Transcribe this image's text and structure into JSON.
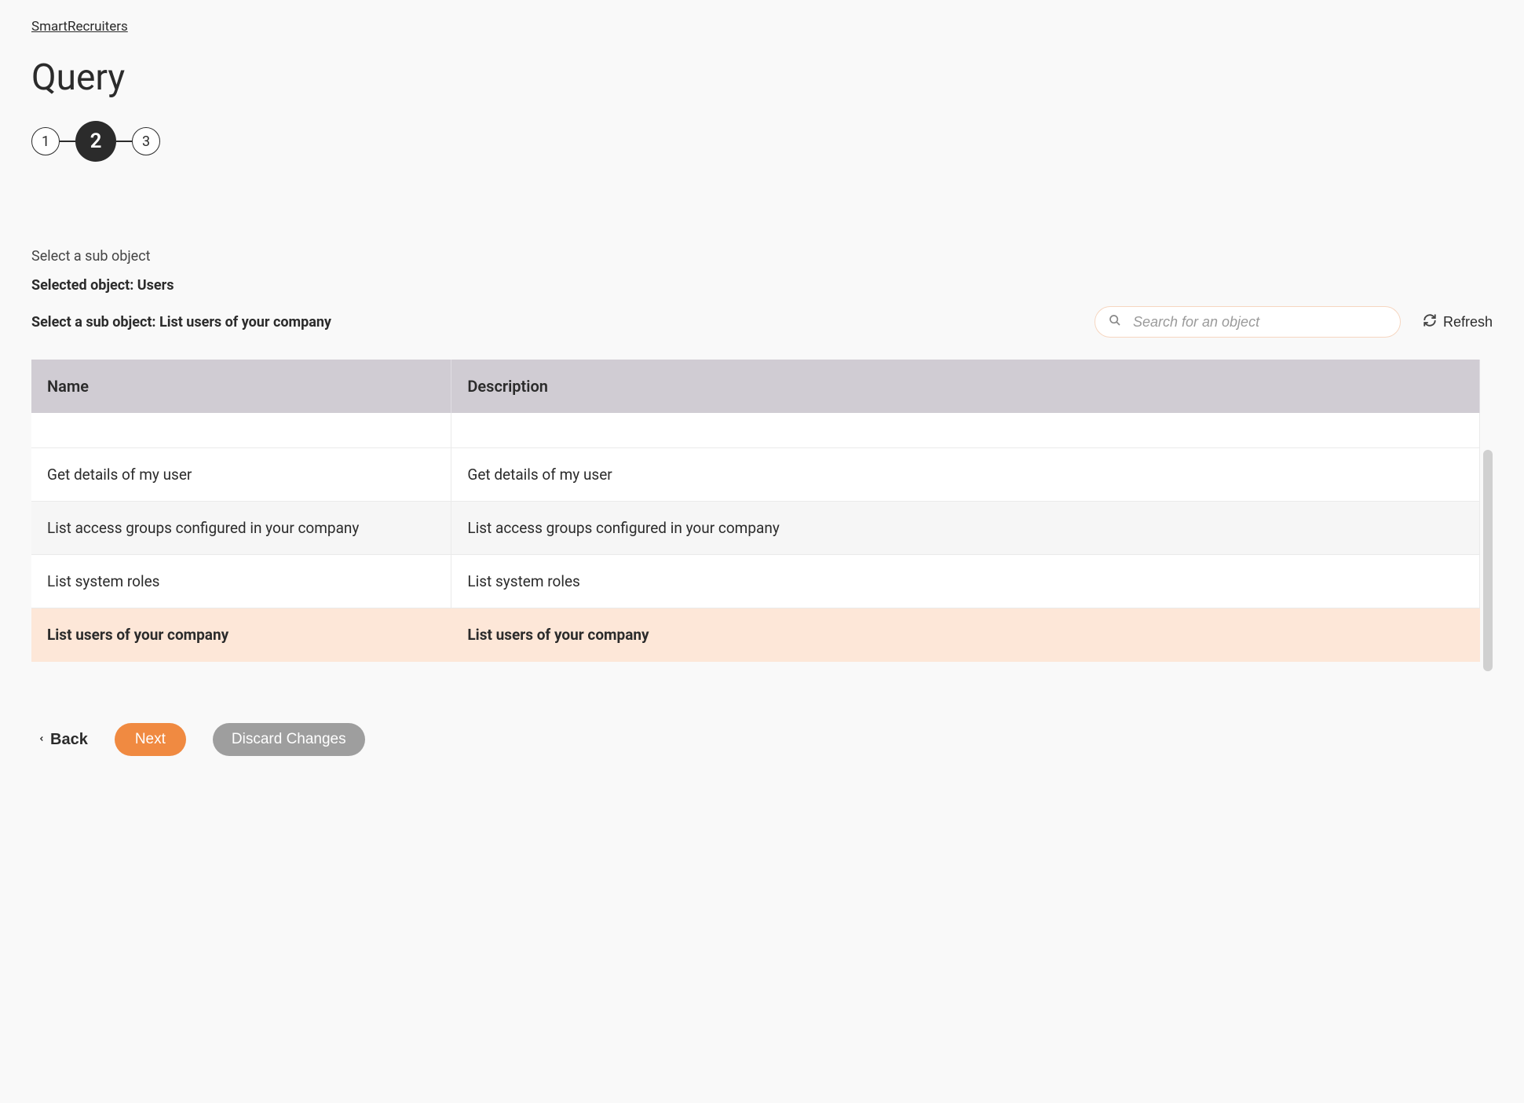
{
  "breadcrumb": "SmartRecruiters",
  "page_title": "Query",
  "stepper": {
    "steps": [
      "1",
      "2",
      "3"
    ],
    "active_index": 1
  },
  "labels": {
    "select_sub_object": "Select a sub object",
    "selected_object_prefix": "Selected object: ",
    "selected_object_value": "Users",
    "select_sub_object_prefix": "Select a sub object: ",
    "select_sub_object_value": "List users of your company"
  },
  "search": {
    "placeholder": "Search for an object"
  },
  "refresh_label": "Refresh",
  "table": {
    "headers": {
      "name": "Name",
      "description": "Description"
    },
    "rows": [
      {
        "name": "Get details of my user",
        "description": "Get details of my user",
        "alt": false,
        "selected": false
      },
      {
        "name": "List access groups configured in your company",
        "description": "List access groups configured in your company",
        "alt": true,
        "selected": false
      },
      {
        "name": "List system roles",
        "description": "List system roles",
        "alt": false,
        "selected": false
      },
      {
        "name": "List users of your company",
        "description": "List users of your company",
        "alt": false,
        "selected": true
      }
    ]
  },
  "footer": {
    "back": "Back",
    "next": "Next",
    "discard": "Discard Changes"
  }
}
